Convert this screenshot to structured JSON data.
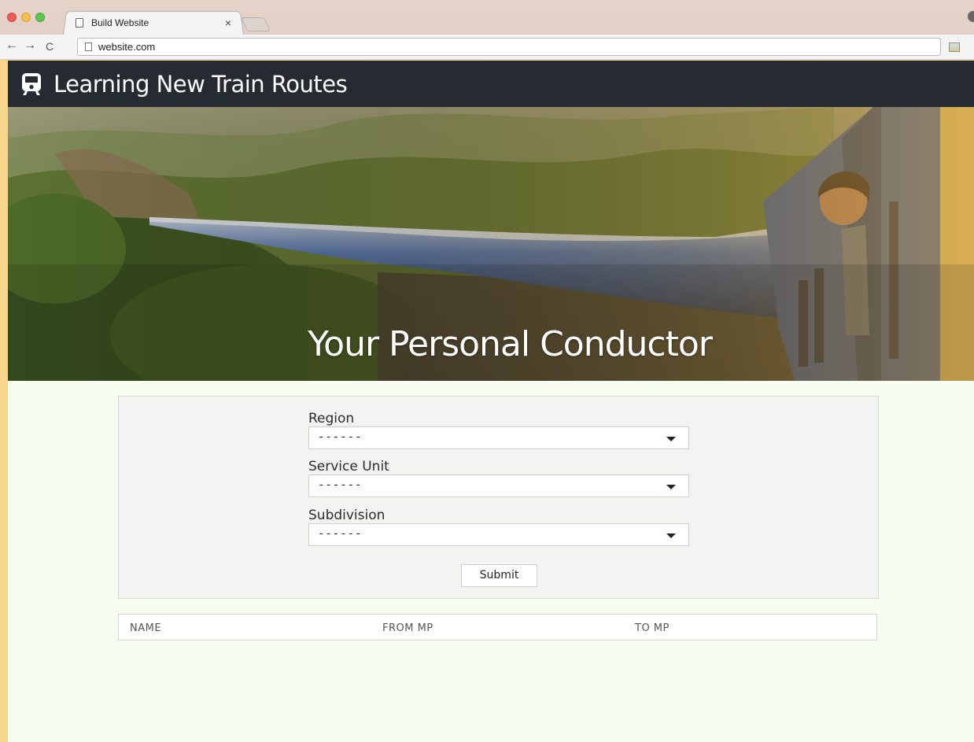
{
  "browser": {
    "tab_title": "Build Website",
    "tab_close": "×",
    "url": "website.com",
    "back": "←",
    "forward": "→",
    "reload": "C"
  },
  "navbar": {
    "brand": "Learning New Train Routes",
    "icon": "train-icon"
  },
  "hero": {
    "title": "Your Personal Conductor"
  },
  "form": {
    "fields": [
      {
        "label": "Region",
        "value": "------"
      },
      {
        "label": "Service Unit",
        "value": "------"
      },
      {
        "label": "Subdivision",
        "value": "------"
      }
    ],
    "submit_label": "Submit"
  },
  "table": {
    "columns": [
      "NAME",
      "FROM MP",
      "TO MP"
    ]
  },
  "colors": {
    "navbar_bg": "#262b31",
    "page_bg": "#f7fdf1",
    "outer_bg": "#f6d894"
  }
}
